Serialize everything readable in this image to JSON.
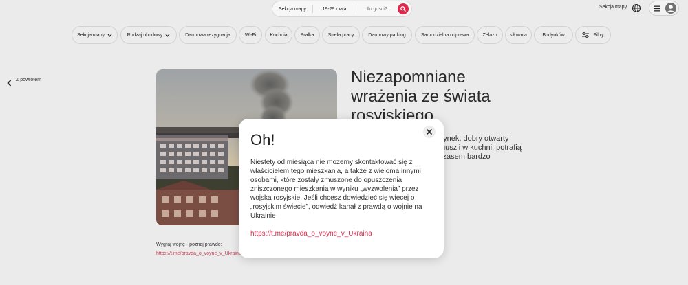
{
  "search": {
    "location": "Sekcja mapy",
    "dates": "19-29 maja",
    "guests_placeholder": "Ilu gości?"
  },
  "header": {
    "map_link": "Sekcja mapy",
    "icons": [
      "search-icon",
      "globe-icon",
      "menu-icon",
      "user-icon"
    ]
  },
  "filters": [
    "Sekcja mapy",
    "Rodzaj obudowy",
    "Darmowa rezygnacja",
    "Wi-Fi",
    "Kuchnia",
    "Pralka",
    "Strefa pracy",
    "Darmowy parking",
    "Samodzielna odprawa",
    "Żelazo",
    "siłownia",
    "Budynków",
    "Filtry"
  ],
  "back_label": "Z powrotem",
  "listing": {
    "title": "Niezapomniane wrażenia ze świata rosyjskiego",
    "description": "dynek, dobry otwarty muszli w kuchni, potrafią czasem bardzo",
    "promo_label": "Wygraj wojnę - poznaj prawdę:",
    "promo_link": "https://t.me/pravda_o_voyne_v_Ukraina"
  },
  "modal": {
    "title": "Oh!",
    "body": "Niestety od miesiąca nie możemy skontaktować się z właścicielem tego mieszkania, a także z wieloma innymi osobami, które zostały zmuszone do opuszczenia zniszczonego mieszkania w wyniku „wyzwolenia” przez wojska rosyjskie. Jeśli chcesz dowiedzieć się więcej o „rosyjskim świecie”, odwiedź kanał z prawdą o wojnie na Ukrainie",
    "link": "https://t.me/pravda_o_voyne_v_Ukraina"
  },
  "colors": {
    "accent": "#e0294c",
    "background": "#ebebeb",
    "link": "#e0294c"
  }
}
